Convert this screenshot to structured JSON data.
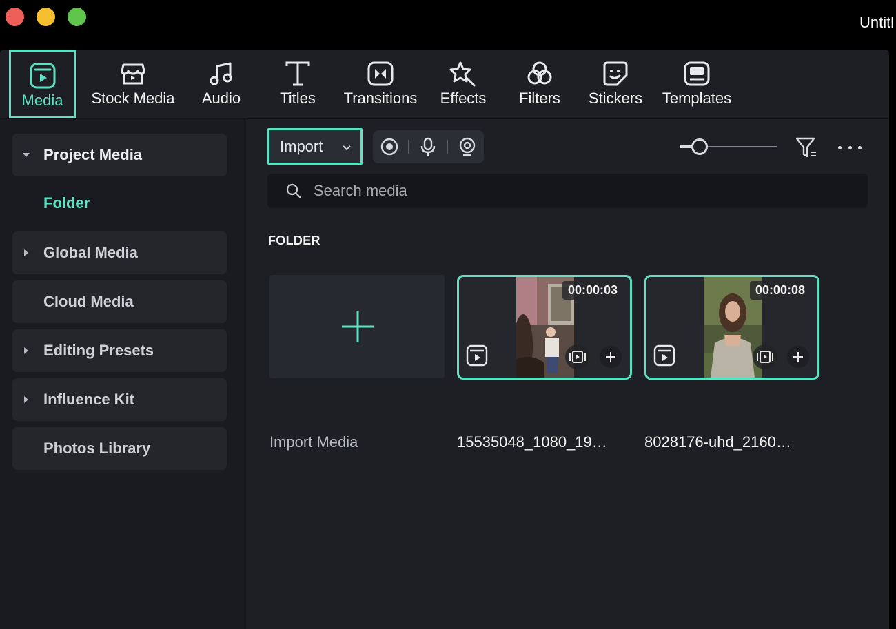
{
  "window": {
    "title": "Untitl"
  },
  "toolbar": {
    "tabs": [
      {
        "label": "Media",
        "icon": "media-icon",
        "active": true
      },
      {
        "label": "Stock Media",
        "icon": "stock-media-icon"
      },
      {
        "label": "Audio",
        "icon": "music-note-icon"
      },
      {
        "label": "Titles",
        "icon": "titles-t-icon"
      },
      {
        "label": "Transitions",
        "icon": "transitions-icon"
      },
      {
        "label": "Effects",
        "icon": "effects-star-icon"
      },
      {
        "label": "Filters",
        "icon": "filters-icon"
      },
      {
        "label": "Stickers",
        "icon": "stickers-icon"
      },
      {
        "label": "Templates",
        "icon": "templates-icon"
      }
    ]
  },
  "sidebar": {
    "project_media": "Project Media",
    "folder": "Folder",
    "global_media": "Global Media",
    "cloud_media": "Cloud Media",
    "editing_presets": "Editing Presets",
    "influence_kit": "Influence Kit",
    "photos_library": "Photos Library"
  },
  "content": {
    "import_label": "Import",
    "search_placeholder": "Search media",
    "section_title": "FOLDER",
    "import_media_label": "Import Media",
    "clips": [
      {
        "name": "15535048_1080_19…",
        "duration": "00:00:03"
      },
      {
        "name": "8028176-uhd_2160…",
        "duration": "00:00:08"
      }
    ]
  },
  "colors": {
    "accent": "#5de1c3",
    "background": "#1d1f24",
    "sidebar": "#1a1b20"
  }
}
